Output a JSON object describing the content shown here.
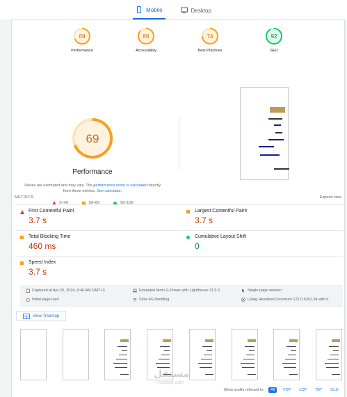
{
  "tabs": [
    {
      "label": "Mobile",
      "active": true
    },
    {
      "label": "Desktop",
      "active": false
    }
  ],
  "gauges": [
    {
      "score": "69",
      "label": "Performance",
      "color": "#fa9f1b",
      "fraction": 0.69
    },
    {
      "score": "86",
      "label": "Accessibility",
      "color": "#fa9f1b",
      "fraction": 0.86
    },
    {
      "score": "74",
      "label": "Best Practices",
      "color": "#fa9f1b",
      "fraction": 0.74
    },
    {
      "score": "92",
      "label": "SEO",
      "color": "#0cce6b",
      "fraction": 0.92
    }
  ],
  "performance": {
    "score": "69",
    "fraction": 0.69,
    "title": "Performance",
    "note_prefix": "Values are estimated and may vary. The ",
    "note_link1": "performance score is calculated",
    "note_mid": " directly from these metrics. ",
    "note_link2": "See calculator."
  },
  "legend": [
    {
      "label": "0–49",
      "shape": "triangle",
      "color": "#e53935"
    },
    {
      "label": "50–89",
      "shape": "square",
      "color": "#fa9f1b"
    },
    {
      "label": "90–100",
      "shape": "circle",
      "color": "#0cce6b"
    }
  ],
  "metrics_header": {
    "title": "METRICS",
    "expand": "Expand view"
  },
  "metrics": [
    {
      "name": "First Contentful Paint",
      "value": "3.7 s",
      "status": "red"
    },
    {
      "name": "Largest Contentful Paint",
      "value": "3.7 s",
      "status": "red"
    },
    {
      "name": "Total Blocking Time",
      "value": "460 ms",
      "status": "orange"
    },
    {
      "name": "Cumulative Layout Shift",
      "value": "0",
      "status": "green"
    },
    {
      "name": "Speed Index",
      "value": "3.7 s",
      "status": "orange"
    }
  ],
  "info": {
    "captured": "Captured at Apr 26, 2024, 9:46 AM GMT+3",
    "initial_load": "Initial page load",
    "emulated": "Emulated Moto G Power with Lighthouse 11.5.0",
    "throttling": "Slow 4G throttling",
    "session": "Single page session",
    "browser": "Using HeadlessChromium 122.0.6261.94 with lr"
  },
  "treemap_label": "View Treemap",
  "watermark": {
    "arabic": "مستقل",
    "latin": "mostaql.com"
  },
  "filter": {
    "label": "Show audits relevant to:",
    "chips": [
      "All",
      "FCP",
      "LCP",
      "TBT",
      "CLS"
    ]
  },
  "colors": {
    "accent": "#1a73e8",
    "poor": "#e53935",
    "average": "#fa9f1b",
    "good": "#0cce6b"
  }
}
